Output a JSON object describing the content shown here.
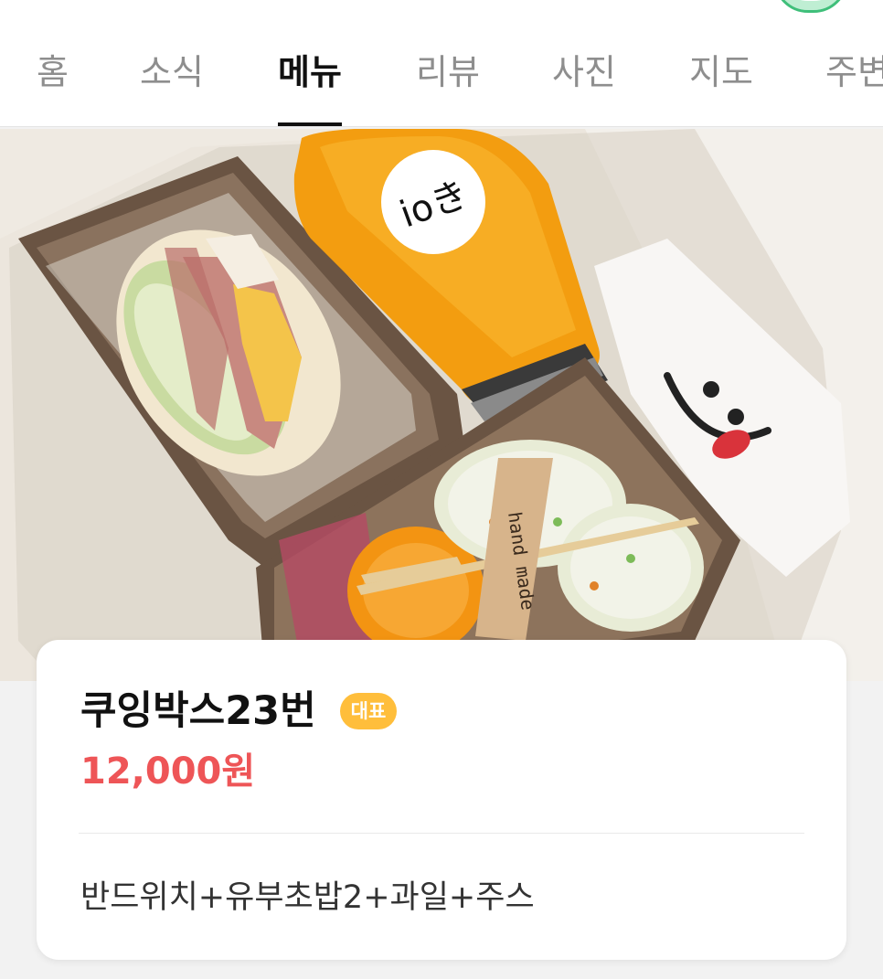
{
  "tabs": [
    {
      "label": "홈",
      "active": false
    },
    {
      "label": "소식",
      "active": false
    },
    {
      "label": "메뉴",
      "active": true
    },
    {
      "label": "리뷰",
      "active": false
    },
    {
      "label": "사진",
      "active": false
    },
    {
      "label": "지도",
      "active": false
    },
    {
      "label": "주변",
      "active": false
    }
  ],
  "photo": {
    "card_text": "hand made",
    "bottle_label": "ioき"
  },
  "menu_item": {
    "name": "쿠잉박스23번",
    "badge": "대표",
    "price": "12,000원",
    "description": "반드위치+유부초밥2+과일+주스"
  },
  "colors": {
    "active_tab": "#111111",
    "inactive_tab": "#8e8e8e",
    "badge": "#ffbe3b",
    "price": "#ee5557"
  }
}
